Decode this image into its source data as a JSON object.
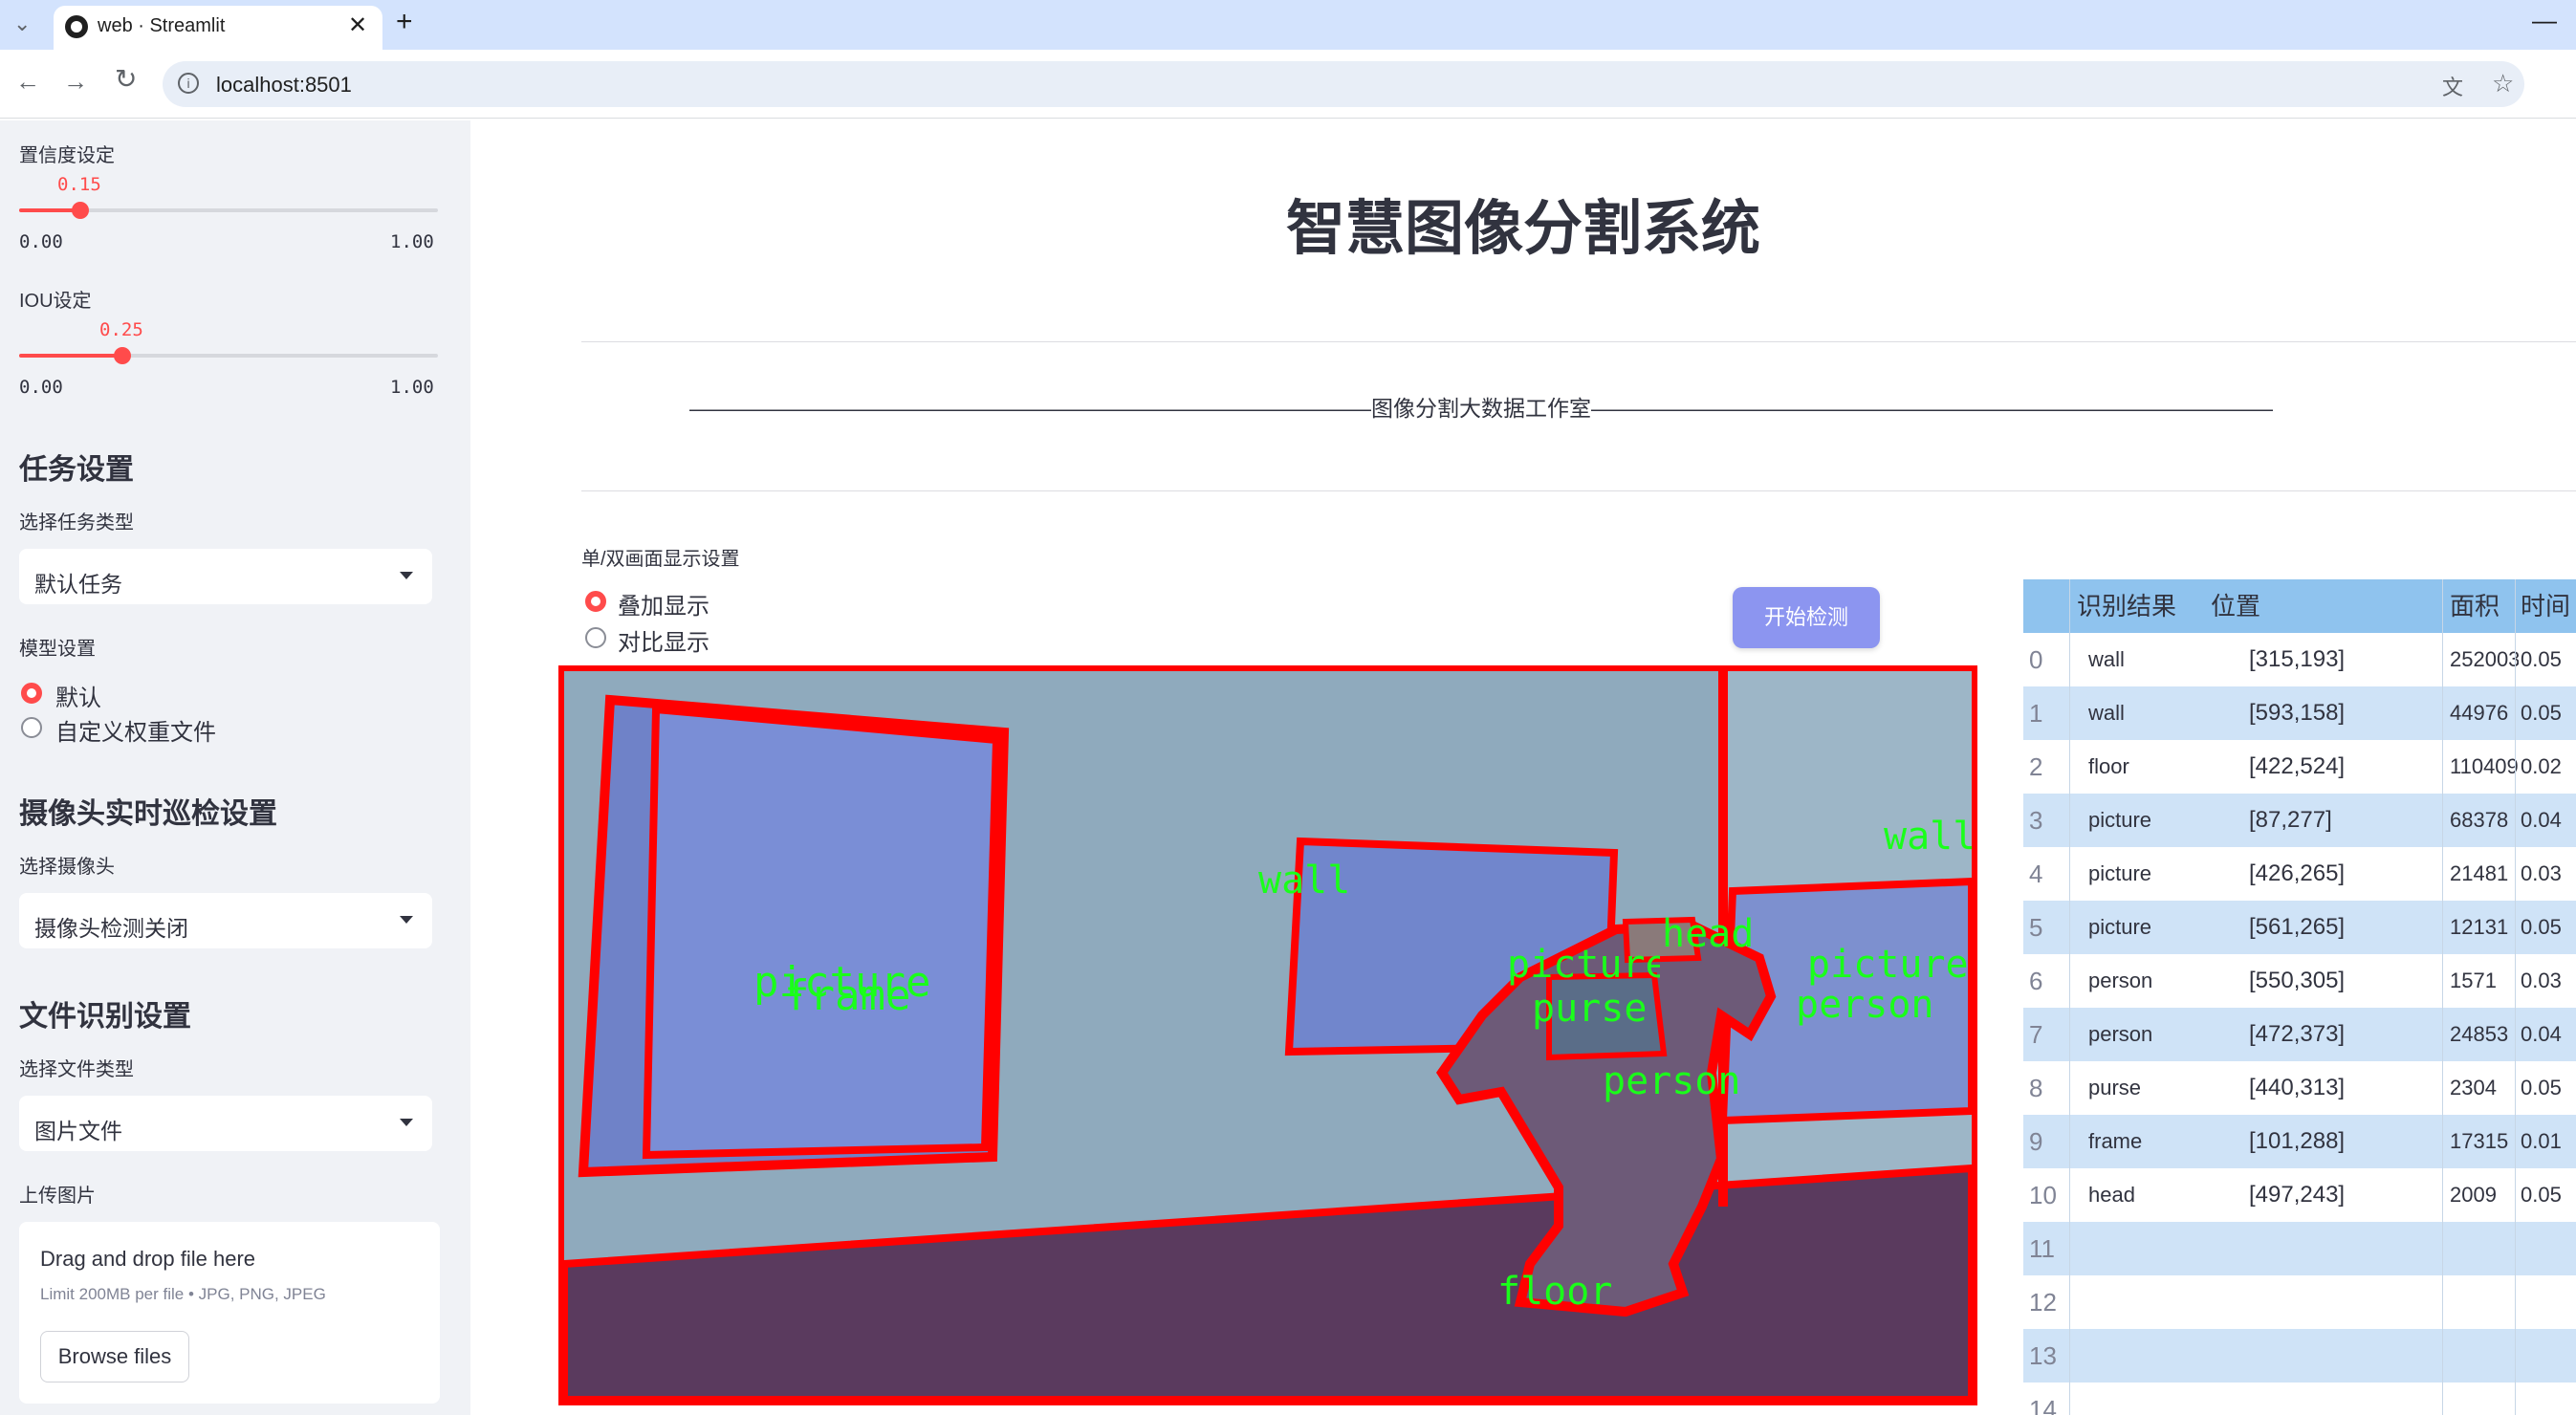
{
  "browser": {
    "tab_title": "web · Streamlit",
    "url": "localhost:8501"
  },
  "sidebar": {
    "confidence": {
      "label": "置信度设定",
      "value": "0.15",
      "min": "0.00",
      "max": "1.00",
      "fraction": 0.15
    },
    "iou": {
      "label": "IOU设定",
      "value": "0.25",
      "min": "0.00",
      "max": "1.00",
      "fraction": 0.25
    },
    "task_heading": "任务设置",
    "task_type_label": "选择任务类型",
    "task_type_value": "默认任务",
    "model_label": "模型设置",
    "model_options": [
      "默认",
      "自定义权重文件"
    ],
    "model_selected": 0,
    "camera_heading": "摄像头实时巡检设置",
    "camera_label": "选择摄像头",
    "camera_value": "摄像头检测关闭",
    "file_heading": "文件识别设置",
    "file_type_label": "选择文件类型",
    "file_type_value": "图片文件",
    "upload_label": "上传图片",
    "upload_drop_text": "Drag and drop file here",
    "upload_limit_text": "Limit 200MB per file • JPG, PNG, JPEG",
    "browse_label": "Browse files"
  },
  "main": {
    "title": "智慧图像分割系统",
    "banner": "———————————————————————————————图像分割大数据工作室———————————————————————————————",
    "display_label": "单/双画面显示设置",
    "display_options": [
      "叠加显示",
      "对比显示"
    ],
    "display_selected": 0,
    "start_button": "开始检测",
    "detection_labels": [
      "picture",
      "frame",
      "wall",
      "head",
      "picture",
      "purse",
      "person",
      "picture",
      "person",
      "wall",
      "floor"
    ]
  },
  "table": {
    "headers": [
      "识别结果",
      "位置",
      "面积",
      "时间"
    ],
    "rows": [
      {
        "idx": "0",
        "label": "wall",
        "pos": "[315,193]",
        "area": "252003",
        "time": "0.05"
      },
      {
        "idx": "1",
        "label": "wall",
        "pos": "[593,158]",
        "area": "44976",
        "time": "0.05"
      },
      {
        "idx": "2",
        "label": "floor",
        "pos": "[422,524]",
        "area": "110409",
        "time": "0.02"
      },
      {
        "idx": "3",
        "label": "picture",
        "pos": "[87,277]",
        "area": "68378",
        "time": "0.04"
      },
      {
        "idx": "4",
        "label": "picture",
        "pos": "[426,265]",
        "area": "21481",
        "time": "0.03"
      },
      {
        "idx": "5",
        "label": "picture",
        "pos": "[561,265]",
        "area": "12131",
        "time": "0.05"
      },
      {
        "idx": "6",
        "label": "person",
        "pos": "[550,305]",
        "area": "1571",
        "time": "0.03"
      },
      {
        "idx": "7",
        "label": "person",
        "pos": "[472,373]",
        "area": "24853",
        "time": "0.04"
      },
      {
        "idx": "8",
        "label": "purse",
        "pos": "[440,313]",
        "area": "2304",
        "time": "0.05"
      },
      {
        "idx": "9",
        "label": "frame",
        "pos": "[101,288]",
        "area": "17315",
        "time": "0.01"
      },
      {
        "idx": "10",
        "label": "head",
        "pos": "[497,243]",
        "area": "2009",
        "time": "0.05"
      },
      {
        "idx": "11",
        "label": "",
        "pos": "",
        "area": "",
        "time": ""
      },
      {
        "idx": "12",
        "label": "",
        "pos": "",
        "area": "",
        "time": ""
      },
      {
        "idx": "13",
        "label": "",
        "pos": "",
        "area": "",
        "time": ""
      },
      {
        "idx": "14",
        "label": "",
        "pos": "",
        "area": "",
        "time": ""
      }
    ]
  },
  "colors": {
    "accent": "#ff4b4b",
    "mask_outline": "#ff0000",
    "label_text": "#1aff1a",
    "table_header": "#8fc3ee",
    "table_stripe": "#cfe3f7"
  }
}
